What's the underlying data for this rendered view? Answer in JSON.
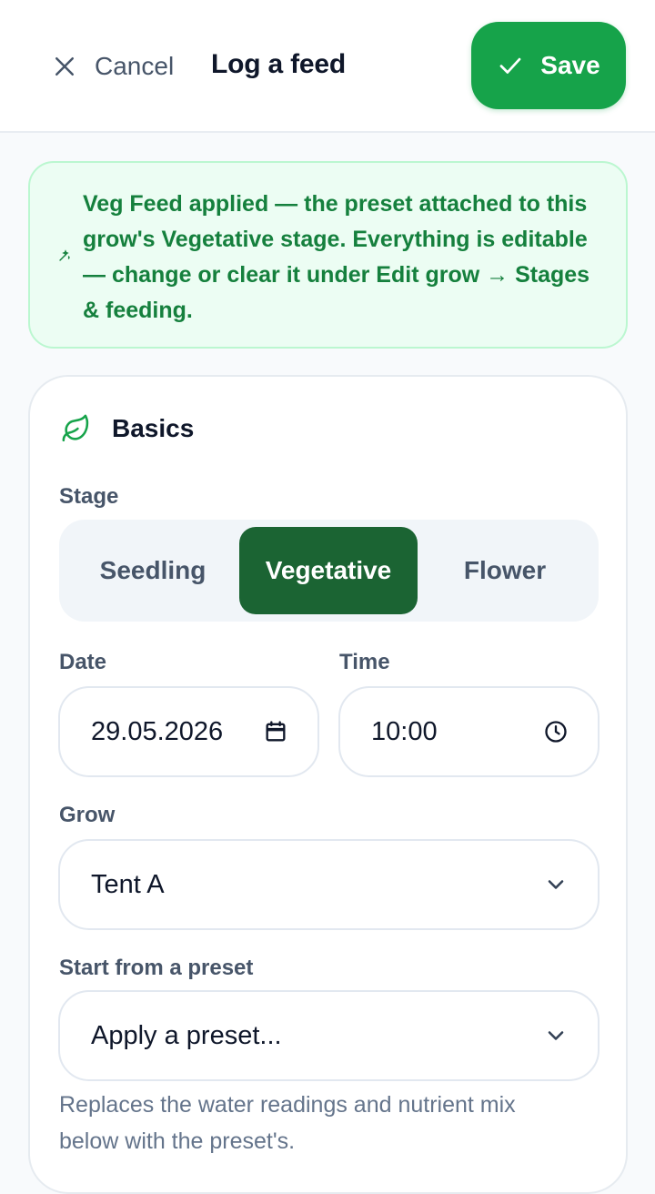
{
  "header": {
    "cancel_label": "Cancel",
    "title": "Log a feed",
    "save_label": "Save"
  },
  "notice": {
    "text": "Veg Feed applied — the preset attached to this grow's Vegetative stage. Everything is editable — change or clear it under Edit grow → Stages & feeding."
  },
  "basics": {
    "title": "Basics",
    "stage_label": "Stage",
    "stages": [
      "Seedling",
      "Vegetative",
      "Flower"
    ],
    "selected_stage": "Vegetative",
    "date_label": "Date",
    "date_value": "29.05.2026",
    "time_label": "Time",
    "time_value": "10:00",
    "grow_label": "Grow",
    "grow_value": "Tent A",
    "preset_label": "Start from a preset",
    "preset_value": "Apply a preset...",
    "preset_help": "Replaces the water readings and nutrient mix below with the preset's."
  },
  "colors": {
    "accent": "#16a34a",
    "accent_dark": "#1b6433",
    "notice_bg": "#ecfdf3",
    "notice_text": "#15803d"
  },
  "icons": {
    "cancel": "close-icon",
    "save": "check-icon",
    "notice": "sparkle-icon",
    "basics": "leaf-icon",
    "date": "calendar-icon",
    "time": "clock-icon",
    "select": "chevron-down-icon"
  }
}
